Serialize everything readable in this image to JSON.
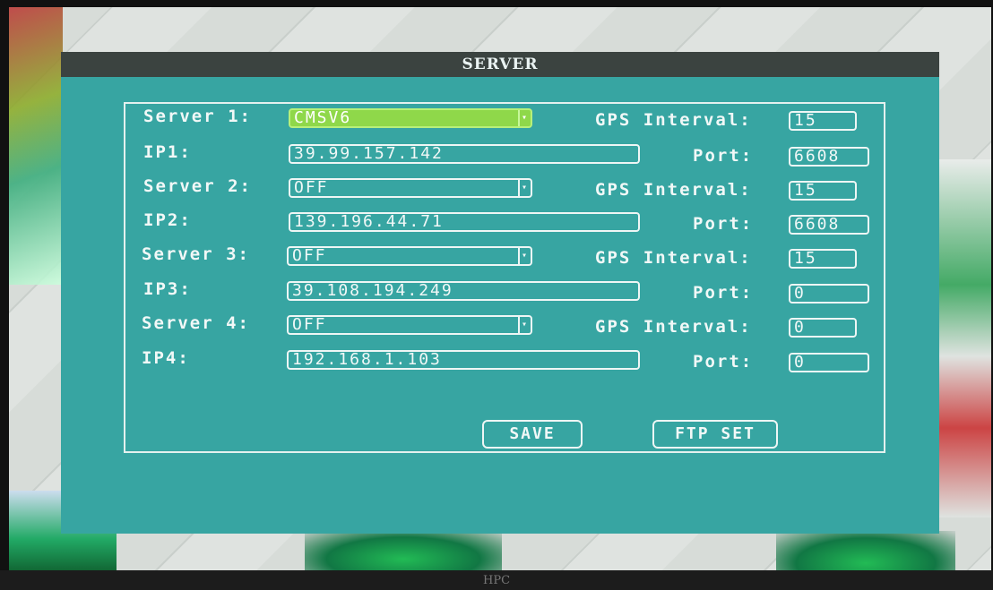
{
  "dialog": {
    "title": "SERVER"
  },
  "servers": [
    {
      "label": "Server 1:",
      "value": "CMSV6",
      "ip_label": "IP1:",
      "ip": "39.99.157.142",
      "gps_label": "GPS Interval:",
      "gps_interval": "15",
      "port_label": "Port:",
      "port": "6608"
    },
    {
      "label": "Server 2:",
      "value": "OFF",
      "ip_label": "IP2:",
      "ip": "139.196.44.71",
      "gps_label": "GPS Interval:",
      "gps_interval": "15",
      "port_label": "Port:",
      "port": "6608"
    },
    {
      "label": "Server 3:",
      "value": "OFF",
      "ip_label": "IP3:",
      "ip": "39.108.194.249",
      "gps_label": "GPS Interval:",
      "gps_interval": "15",
      "port_label": "Port:",
      "port": "0"
    },
    {
      "label": "Server 4:",
      "value": "OFF",
      "ip_label": "IP4:",
      "ip": "192.168.1.103",
      "gps_label": "GPS Interval:",
      "gps_interval": "0",
      "port_label": "Port:",
      "port": "0"
    }
  ],
  "buttons": {
    "save": "SAVE",
    "ftp_set": "FTP SET"
  },
  "icons": {
    "dropdown": "dropdown-arrow-icon"
  },
  "colors": {
    "panel": "#37a5a2",
    "titlebar": "#3b4340",
    "focus": "#8fd84a"
  },
  "monitor": {
    "brand": "HPC"
  }
}
